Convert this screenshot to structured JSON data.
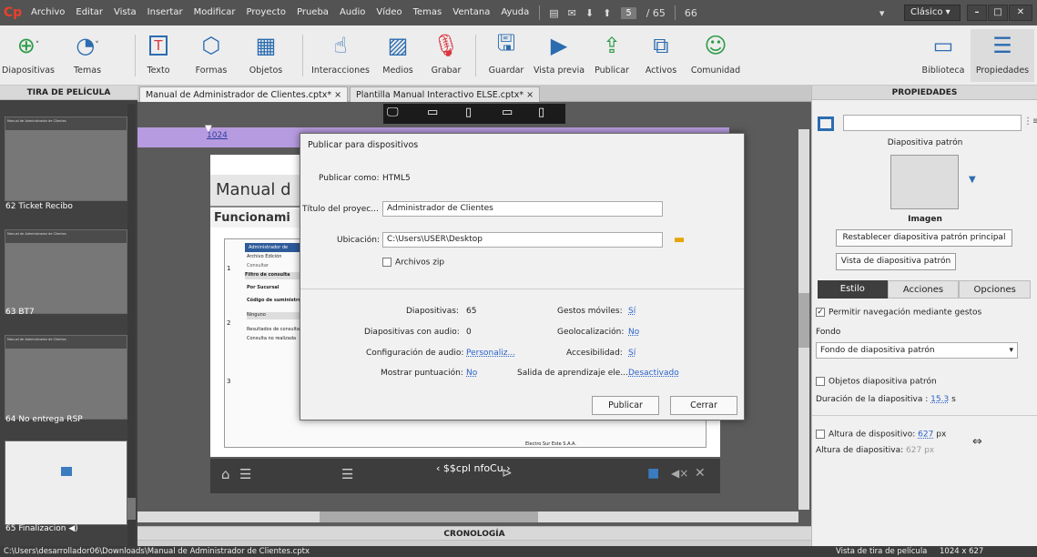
{
  "menubar": {
    "logo": "Cp",
    "items": [
      "Archivo",
      "Editar",
      "Vista",
      "Insertar",
      "Modificar",
      "Proyecto",
      "Prueba",
      "Audio",
      "Vídeo",
      "Temas",
      "Ventana",
      "Ayuda"
    ],
    "slide_current": "5",
    "slide_total": "/ 65",
    "zoom": "66",
    "workspace": "Clásico"
  },
  "toolbar": {
    "items": [
      {
        "label": "Diapositivas",
        "icon": "add-slide-icon"
      },
      {
        "label": "Temas",
        "icon": "themes-icon"
      },
      {
        "label": "Texto",
        "icon": "text-icon"
      },
      {
        "label": "Formas",
        "icon": "shapes-icon"
      },
      {
        "label": "Objetos",
        "icon": "objects-icon"
      },
      {
        "label": "Interacciones",
        "icon": "interactions-icon"
      },
      {
        "label": "Medios",
        "icon": "media-icon"
      },
      {
        "label": "Grabar",
        "icon": "microphone-icon"
      },
      {
        "label": "Guardar",
        "icon": "save-icon"
      },
      {
        "label": "Vista previa",
        "icon": "preview-icon"
      },
      {
        "label": "Publicar",
        "icon": "publish-icon"
      },
      {
        "label": "Activos",
        "icon": "assets-icon"
      },
      {
        "label": "Comunidad",
        "icon": "community-icon"
      },
      {
        "label": "Biblioteca",
        "icon": "library-icon"
      },
      {
        "label": "Propiedades",
        "icon": "properties-icon"
      }
    ]
  },
  "filmstrip": {
    "title": "TIRA DE PELÍCULA",
    "slides": [
      {
        "label": "62 Ticket Recibo",
        "head": "Manual de Administrador de Clientes"
      },
      {
        "label": "63 BT7",
        "head": "Manual de Administrador de Clientes"
      },
      {
        "label": "64 No entrega RSP",
        "head": "Manual de Administrador de Clientes"
      },
      {
        "label": "65 Finalizacion",
        "head": ""
      }
    ]
  },
  "tabs": [
    "Manual de Administrador de Clientes.cptx*",
    "Plantilla Manual Interactivo ELSE.cptx*"
  ],
  "tab_close": "×",
  "canvas": {
    "ruler_value": "1024",
    "slide_title": "Manual d",
    "slide_subtitle": "Funcionami",
    "footer_text": "Electro Sur Este S.A.A.",
    "app_title": "Administrador de",
    "app_menu": "Archivo   Edición",
    "consult": "Consultar",
    "filter_hdr": "Filtro de consulta",
    "sucursal": "Por Sucursal",
    "codigo": "Código de suministro",
    "ninguno": "Ninguno",
    "result": "Resultados de consulta",
    "realizada": "Consulta no realizada",
    "nav_label": "$$cpl nfoCu",
    "nums": [
      "1",
      "2",
      "3"
    ]
  },
  "timeline": "CRONOLOGÍA",
  "dialog": {
    "title": "Publicar para dispositivos",
    "publish_as_label": "Publicar como:",
    "publish_as_value": "HTML5",
    "project_title_label": "Título del proyec...",
    "project_title_value": "Administrador de Clientes",
    "location_label": "Ubicación:",
    "location_value": "C:\\Users\\USER\\Desktop",
    "zip_label": "Archivos zip",
    "slides_label": "Diapositivas:",
    "slides_value": "65",
    "audio_slides_label": "Diapositivas con audio:",
    "audio_slides_value": "0",
    "audio_config_label": "Configuración de audio:",
    "audio_config_value": "Personaliz...",
    "score_label": "Mostrar puntuación:",
    "score_value": "No",
    "gestures_label": "Gestos móviles:",
    "gestures_value": "Sí",
    "geo_label": "Geolocalización:",
    "geo_value": "No",
    "access_label": "Accesibilidad:",
    "access_value": "Sí",
    "lms_label": "Salida de aprendizaje ele...",
    "lms_value": "Desactivado",
    "publish_btn": "Publicar",
    "close_btn": "Cerrar"
  },
  "props": {
    "title": "PROPIEDADES",
    "master_label": "Diapositiva patrón",
    "image_label": "Imagen",
    "reset_btn": "Restablecer diapositiva patrón principal",
    "view_btn": "Vista de diapositiva patrón",
    "tabs": [
      "Estilo",
      "Acciones",
      "Opciones"
    ],
    "gesture_nav": "Permitir navegación mediante gestos",
    "bg_label": "Fondo",
    "bg_value": "Fondo de diapositiva patrón",
    "master_objects": "Objetos diapositiva patrón",
    "duration_label": "Duración de la diapositiva :",
    "duration_value": "15.3",
    "duration_unit": "s",
    "dev_height_cb": "Altura de dispositivo:",
    "dev_height_value": "627",
    "dev_height_unit": "px",
    "dev_height2": "Altura de diapositiva:",
    "dev_height2_value": "627",
    "dev_height2_unit": "px"
  },
  "status": {
    "path": "C:\\Users\\desarrollador06\\Downloads\\Manual de Administrador de Clientes.cptx",
    "view": "Vista de tira de película",
    "size": "1024 x 627"
  },
  "colors": {
    "accent": "#2a62c9",
    "logo": "#e8412c",
    "dark": "#535353"
  }
}
